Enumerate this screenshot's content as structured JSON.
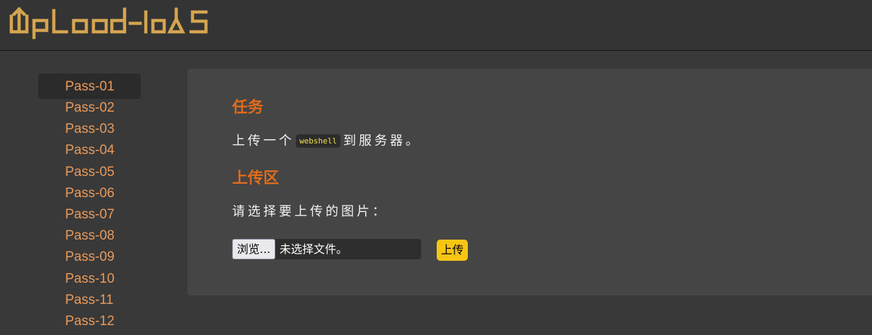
{
  "header": {
    "logo_text": "Upload-labs",
    "logo_color": "#d4a450"
  },
  "sidebar": {
    "items": [
      {
        "label": "Pass-01",
        "active": true
      },
      {
        "label": "Pass-02"
      },
      {
        "label": "Pass-03"
      },
      {
        "label": "Pass-04"
      },
      {
        "label": "Pass-05"
      },
      {
        "label": "Pass-06"
      },
      {
        "label": "Pass-07"
      },
      {
        "label": "Pass-08"
      },
      {
        "label": "Pass-09"
      },
      {
        "label": "Pass-10"
      },
      {
        "label": "Pass-11"
      },
      {
        "label": "Pass-12"
      }
    ],
    "link_color": "#e89a5c"
  },
  "main": {
    "task_title": "任务",
    "task_prefix": "上传一个",
    "task_code": "webshell",
    "task_suffix": "到服务器。",
    "upload_title": "上传区",
    "prompt": "请选择要上传的图片：",
    "browse_label": "浏览...",
    "file_status": "未选择文件。",
    "upload_label": "上传",
    "accent_color": "#e06c1c",
    "button_color": "#f7c513"
  }
}
